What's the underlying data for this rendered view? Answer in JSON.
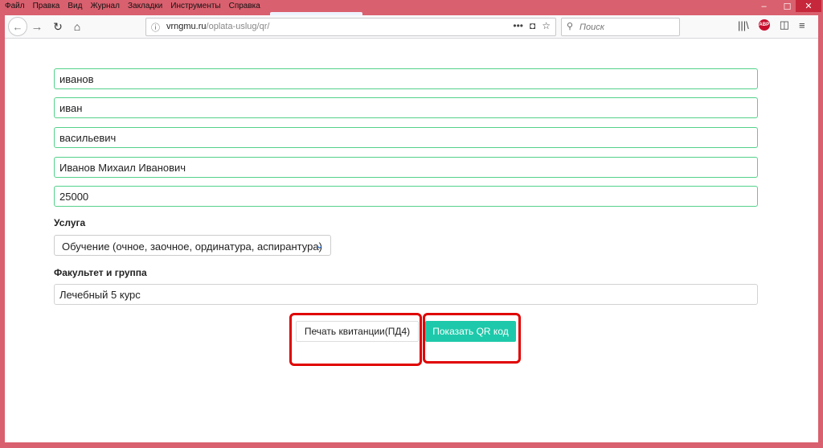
{
  "menu": [
    "Файл",
    "Правка",
    "Вид",
    "Журнал",
    "Закладки",
    "Инструменты",
    "Справка"
  ],
  "window": {
    "min": "–",
    "max": "☐",
    "close": "✕"
  },
  "browser": {
    "url_host": "vrngmu.ru",
    "url_path": "/oplata-uslug/qr/",
    "search_placeholder": "Поиск",
    "abp_label": "ABP"
  },
  "form": {
    "surname": "иванов",
    "name": "иван",
    "patronymic": "васильевич",
    "payer": "Иванов Михаил Иванович",
    "amount": "25000",
    "service_label": "Услуга",
    "service_value": "Обучение (очное, заочное, ординатура, аспирантура)",
    "faculty_label": "Факультет и группа",
    "faculty_value": "Лечебный 5 курс"
  },
  "buttons": {
    "print": "Печать квитанции(ПД4)",
    "show_qr": "Показать QR код"
  },
  "colors": {
    "accent": "#1dc9aa",
    "highlight": "#e00000",
    "field_border": "#54d18a"
  }
}
